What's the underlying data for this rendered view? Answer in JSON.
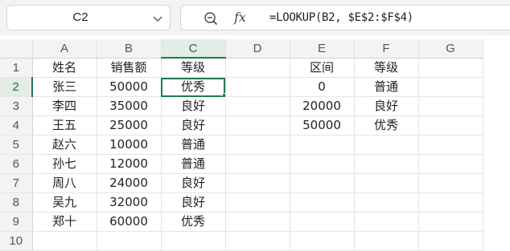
{
  "name_box": {
    "cell_ref": "C2"
  },
  "formula_bar": {
    "formula": "=LOOKUP(B2, $E$2:$F$4)"
  },
  "columns": [
    "A",
    "B",
    "C",
    "D",
    "E",
    "F",
    "G"
  ],
  "rows": [
    {
      "num": "1",
      "cells": [
        "姓名",
        "销售额",
        "等级",
        "",
        "区间",
        "等级",
        ""
      ]
    },
    {
      "num": "2",
      "cells": [
        "张三",
        "50000",
        "优秀",
        "",
        "0",
        "普通",
        ""
      ]
    },
    {
      "num": "3",
      "cells": [
        "李四",
        "35000",
        "良好",
        "",
        "20000",
        "良好",
        ""
      ]
    },
    {
      "num": "4",
      "cells": [
        "王五",
        "25000",
        "良好",
        "",
        "50000",
        "优秀",
        ""
      ]
    },
    {
      "num": "5",
      "cells": [
        "赵六",
        "10000",
        "普通",
        "",
        "",
        "",
        ""
      ]
    },
    {
      "num": "6",
      "cells": [
        "孙七",
        "12000",
        "普通",
        "",
        "",
        "",
        ""
      ]
    },
    {
      "num": "7",
      "cells": [
        "周八",
        "24000",
        "良好",
        "",
        "",
        "",
        ""
      ]
    },
    {
      "num": "8",
      "cells": [
        "吴九",
        "32000",
        "良好",
        "",
        "",
        "",
        ""
      ]
    },
    {
      "num": "9",
      "cells": [
        "郑十",
        "60000",
        "优秀",
        "",
        "",
        "",
        ""
      ]
    },
    {
      "num": "10",
      "cells": [
        "",
        "",
        "",
        "",
        "",
        "",
        ""
      ]
    }
  ],
  "selection": {
    "column": "C",
    "row": "2"
  },
  "colors": {
    "accent": "#1e7a4c",
    "header_bg": "#f3f3f3",
    "selected_header_bg": "#e3ede6"
  },
  "icons": {
    "name_box_dropdown": "chevron-down-icon",
    "zoom": "zoom-out-icon",
    "function": "fx-icon"
  }
}
